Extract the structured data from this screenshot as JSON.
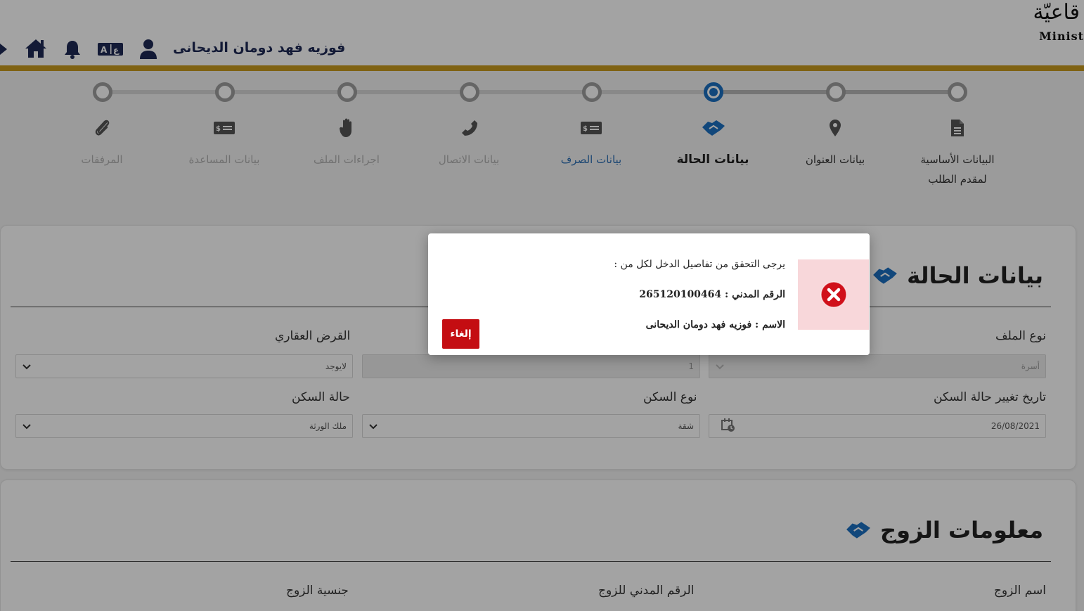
{
  "header": {
    "logo_ar": "قاعيّة",
    "logo_en": "Minist",
    "user_name": "فوزيه فهد دومان الديحانى"
  },
  "colors": {
    "brand_navy": "#1e2a55",
    "accent_gold": "#c79a1f",
    "active_blue": "#1c6fc0",
    "danger_red": "#c40d12"
  },
  "stepper": {
    "steps": [
      {
        "line1": "البيانات الأساسية",
        "line2": "لمقدم الطلب",
        "state": "done",
        "icon": "file-icon"
      },
      {
        "line1": "بيانات العنوان",
        "line2": "",
        "state": "done",
        "icon": "location-pin-icon"
      },
      {
        "line1": "بيانات الحالة",
        "line2": "",
        "state": "current",
        "icon": "handshake-icon"
      },
      {
        "line1": "بيانات الصرف",
        "line2": "",
        "state": "link",
        "icon": "money-bill-icon"
      },
      {
        "line1": "بيانات الاتصال",
        "line2": "",
        "state": "pending",
        "icon": "phone-icon"
      },
      {
        "line1": "اجراءات الملف",
        "line2": "",
        "state": "pending",
        "icon": "hand-icon"
      },
      {
        "line1": "بيانات المساعدة",
        "line2": "",
        "state": "pending",
        "icon": "money-bill-icon"
      },
      {
        "line1": "المرفقات",
        "line2": "",
        "state": "pending",
        "icon": "paperclip-icon"
      }
    ]
  },
  "status_card": {
    "title": "بيانات الحالة",
    "file_type_label": "نوع الملف",
    "file_type_value": "أسرة",
    "count_value": "1",
    "loan_label": "القرض العقاري",
    "loan_value": "لايوجد",
    "housing_change_date_label": "تاريخ تغيير حالة السكن",
    "housing_change_date_value": "26/08/2021",
    "housing_type_label": "نوع السكن",
    "housing_type_value": "شقة",
    "housing_status_label": "حالة السكن",
    "housing_status_value": "ملك الورثة"
  },
  "spouse_card": {
    "title": "معلومات الزوج",
    "spouse_name_label": "اسم الزوج",
    "spouse_civil_id_label": "الرقم المدني للزوج",
    "spouse_nationality_label": "جنسية الزوج"
  },
  "modal": {
    "message": "يرجى التحقق من تفاصيل الدخل لكل من :",
    "civil_id_line": "الرقم المدني : 265120100464",
    "name_line": "الاسم : فوزيه فهد دومان الديحانى",
    "cancel_label": "إلغاء"
  }
}
